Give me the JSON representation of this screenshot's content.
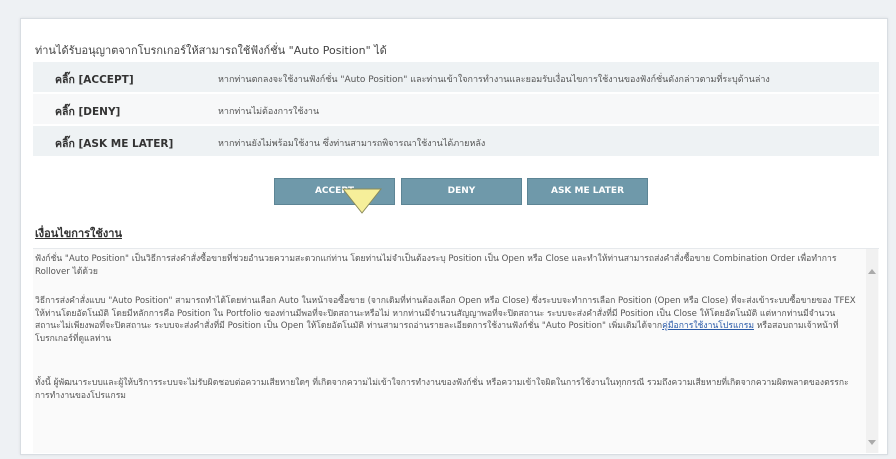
{
  "dialog": {
    "title": "ท่านได้รับอนุญาตจากโบรกเกอร์ให้สามารถใช้ฟังก์ชั่น \"Auto Position\" ได้",
    "options": [
      {
        "key": "คลิ๊ก [ACCEPT]",
        "desc": "หากท่านตกลงจะใช้งานฟังก์ชั่น \"Auto Position\" และท่านเข้าใจการทำงานและยอมรับเงื่อนไขการใช้งานของฟังก์ชั่นดังกล่าวตามที่ระบุด้านล่าง"
      },
      {
        "key": "คลิ๊ก [DENY]",
        "desc": "หากท่านไม่ต้องการใช้งาน"
      },
      {
        "key": "คลิ๊ก [ASK ME LATER]",
        "desc": "หากท่านยังไม่พร้อมใช้งาน ซึ่งท่านสามารถพิจารณาใช้งานได้ภายหลัง"
      }
    ],
    "buttons": {
      "accept": "ACCEPT",
      "deny": "DENY",
      "ask_later": "ASK ME LATER"
    }
  },
  "terms": {
    "title": "เงื่อนไขการใช้งาน",
    "para1": "ฟังก์ชั่น \"Auto Position\" เป็นวิธีการส่งคำสั่งซื้อขายที่ช่วยอำนวยความสะดวกแก่ท่าน โดยท่านไม่จำเป็นต้องระบุ Position เป็น Open หรือ Close และทำให้ท่านสามารถส่งคำสั่งซื้อขาย Combination Order เพื่อทำการ Rollover ได้ด้วย",
    "para2_before": "วิธีการส่งคำสั่งแบบ \"Auto Position\" สามารถทำได้โดยท่านเลือก Auto ในหน้าจอซื้อขาย (จากเดิมที่ท่านต้องเลือก Open หรือ Close) ซึ่งระบบจะทำการเลือก Position (Open หรือ Close) ที่จะส่งเข้าระบบซื้อขายของ TFEX ให้ท่านโดยอัตโนมัติ โดยมีหลักการคือ Position ใน Portfolio ของท่านมีพอที่จะปิดสถานะหรือไม่ หากท่านมีจำนวนสัญญาพอที่จะปิดสถานะ ระบบจะส่งคำสั่งที่มี Position เป็น Close ให้โดยอัตโนมัติ แต่หากท่านมีจำนวนสถานะไม่เพียงพอที่จะปิดสถานะ ระบบจะส่งคำสั่งที่มี Position เป็น Open ให้โดยอัตโนมัติ ท่านสามารถอ่านรายละเอียดการใช้งานฟังก์ชั่น \"Auto Position\" เพิ่มเติมได้จาก",
    "para2_link": "คู่มือการใช้งานโปรแกรม",
    "para2_after": " หรือสอบถามเจ้าหน้าที่โบรกเกอร์ที่ดูแลท่าน",
    "para3": "ทั้งนี้ ผู้พัฒนาระบบและผู้ให้บริการระบบจะไม่รับผิดชอบต่อความเสียหายใดๆ ที่เกิดจากความไม่เข้าใจการทำงานของฟังก์ชั่น หรือความเข้าใจผิดในการใช้งานในทุกกรณี รวมถึงความเสียหายที่เกิดจากความผิดพลาดของตรรกะการทำงานของโปรแกรม"
  },
  "icons": {
    "cursor": "cursor-arrow-icon",
    "scroll_up": "scroll-up-icon",
    "scroll_down": "scroll-down-icon"
  },
  "colors": {
    "button": "#6f99aa",
    "cursor_fill": "#f6ef9a",
    "link": "#2a5aa8"
  }
}
